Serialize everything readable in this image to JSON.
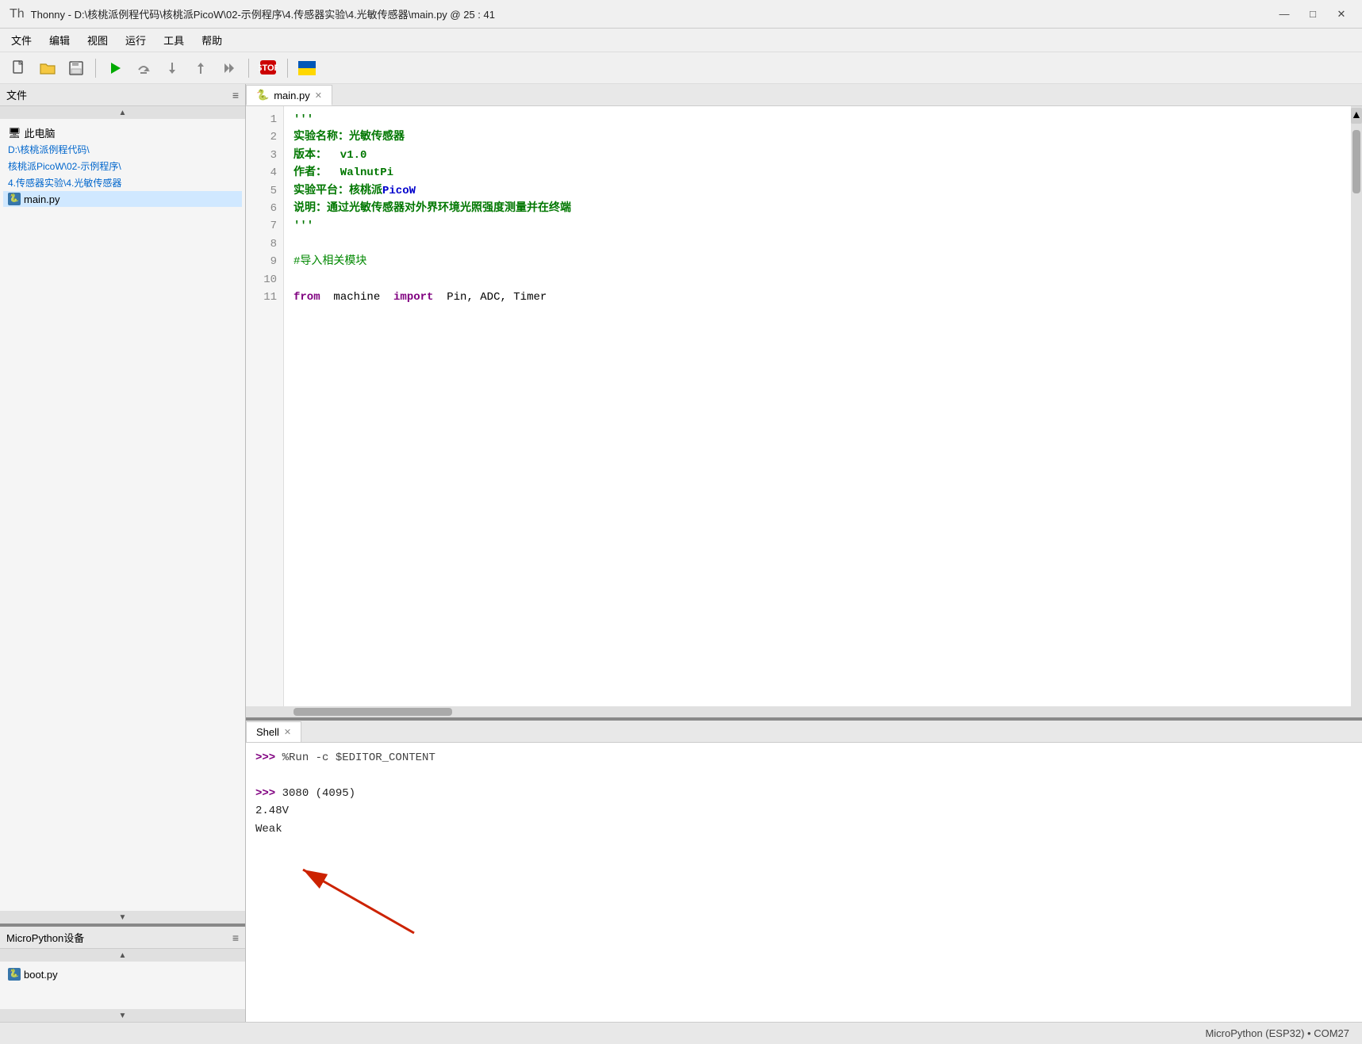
{
  "titlebar": {
    "icon": "Th",
    "title": "Thonny  -  D:\\核桃派例程代码\\核桃派PicoW\\02-示例程序\\4.传感器实验\\4.光敏传感器\\main.py  @  25 : 41",
    "minimize": "—",
    "maximize": "□",
    "close": "✕"
  },
  "menubar": {
    "items": [
      "文件",
      "编辑",
      "视图",
      "运行",
      "工具",
      "帮助"
    ]
  },
  "toolbar": {
    "buttons": [
      "new",
      "open",
      "save",
      "run",
      "debug-over",
      "debug-into",
      "debug-out",
      "resume",
      "stop",
      "ukraine"
    ]
  },
  "left_panel": {
    "file_section": {
      "header": "文件",
      "this_pc": "此电脑",
      "path1": "D:\\核桃派例程代码\\",
      "path2": "核桃派PicoW\\02-示例程序\\",
      "path3": "4.传感器实验\\4.光敏传感器",
      "file": "main.py"
    },
    "micropython_section": {
      "header": "MicroPython设备",
      "file": "boot.py"
    }
  },
  "editor": {
    "tab_label": "main.py",
    "lines": [
      {
        "num": "1",
        "content": "'''",
        "style": "green"
      },
      {
        "num": "2",
        "content": "实验名称：光敏传感器",
        "style": "green"
      },
      {
        "num": "3",
        "content": "版本：  v1.0",
        "style": "green"
      },
      {
        "num": "4",
        "content": "作者：  WalnutPi",
        "style": "green"
      },
      {
        "num": "5",
        "content": "实验平台：核桃派PicoW",
        "style": "green"
      },
      {
        "num": "6",
        "content": "说明：通过光敏传感器对外界环境光照强度测量并在终端",
        "style": "green"
      },
      {
        "num": "7",
        "content": "'''",
        "style": "green"
      },
      {
        "num": "8",
        "content": "",
        "style": "normal"
      },
      {
        "num": "9",
        "content": "#导入相关模块",
        "style": "comment"
      },
      {
        "num": "10",
        "content": "",
        "style": "normal"
      },
      {
        "num": "11",
        "content": "from  machine  import  Pin, ADC, Timer",
        "style": "mixed"
      }
    ]
  },
  "shell": {
    "tab_label": "Shell",
    "lines": [
      {
        "type": "cmd",
        "prompt": ">>> ",
        "text": "%Run -c $EDITOR_CONTENT"
      },
      {
        "type": "blank"
      },
      {
        "type": "cmd",
        "prompt": ">>> ",
        "text": "3080 (4095)"
      },
      {
        "type": "output",
        "text": "2.48V"
      },
      {
        "type": "output",
        "text": "Weak"
      }
    ]
  },
  "statusbar": {
    "text": "MicroPython (ESP32)  •  COM27"
  }
}
